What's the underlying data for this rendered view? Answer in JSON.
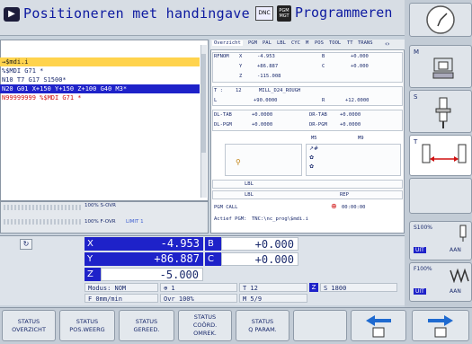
{
  "header": {
    "mode_title": "Positioneren met handingave",
    "dnc": "DNC",
    "pgm_badge": "PGM MGT",
    "program_title": "Programmeren"
  },
  "program": {
    "lines": [
      {
        "text": "→$mdi.i",
        "style": "arrow"
      },
      {
        "text": "%$MDI G71 *",
        "style": "normal"
      },
      {
        "text": "N10 T7 G17 S1500*",
        "style": "normal"
      },
      {
        "text": "N20 G01 X+150 Y+150 Z+100 G40 M3*",
        "style": "selected"
      },
      {
        "text": "N99999999 %$MDI G71 *",
        "style": "red"
      }
    ]
  },
  "status": {
    "tabs": [
      "Overzicht",
      "PGM",
      "PAL",
      "LBL",
      "CYC",
      "M",
      "POS",
      "TOOL",
      "TT",
      "TRANS"
    ],
    "rfnom": {
      "label": "RFNOM",
      "x_label": "X",
      "x": "-4.953",
      "y_label": "Y",
      "y": "+86.887",
      "z_label": "Z",
      "z": "-115.008",
      "b_label": "B",
      "b": "+0.000",
      "c_label": "C",
      "c": "+0.000"
    },
    "tool": {
      "t_label": "T :",
      "t_num": "12",
      "t_name": "MILL_D24_ROUGH",
      "l_label": "L",
      "l": "+90.0000",
      "r_label": "R",
      "r": "+12.0000"
    },
    "dl": {
      "dl_tab_label": "DL-TAB",
      "dl_tab": "+0.0000",
      "dr_tab_label": "DR-TAB",
      "dr_tab": "+0.0000",
      "dl_pgm_label": "DL-PGM",
      "dl_pgm": "+0.0000",
      "dr_pgm_label": "DR-PGM",
      "dr_pgm": "+0.0000"
    },
    "m5": "M5",
    "m9": "M9",
    "lbl1": "LBL",
    "lbl2": "LBL",
    "rep": "REP",
    "pgm_call": "PGM CALL",
    "timer": "00:00:00",
    "active_pgm_label": "Actief PGM:",
    "active_pgm": "TNC:\\nc_prog\\$mdi.i"
  },
  "overrides": {
    "s_ovr": "100% S-OVR",
    "f_ovr": "100% F-OVR",
    "limit": "LIMIT 1"
  },
  "axes": {
    "x_label": "X",
    "x": "-4.953",
    "b_label": "B",
    "b": "+0.000",
    "y_label": "Y",
    "y": "+86.887",
    "c_label": "C",
    "c": "+0.000",
    "z_label": "Z",
    "z": "-5.000",
    "modus": "Modus: NOM",
    "spindle_icon": "⊕ 1",
    "t": "T 12",
    "z_axis": "Z",
    "s": "S 1800",
    "f": "F 0mm/min",
    "ovr": "Ovr 100%",
    "m": "M 5/9"
  },
  "right_panel": {
    "m_key": "M",
    "s_key": "S",
    "t_key": "T",
    "s100": "S100%",
    "uit1": "UIT",
    "aan1": "AAN",
    "f100": "F100%",
    "uit2": "UIT",
    "aan2": "AAN"
  },
  "softkeys": [
    {
      "l1": "STATUS",
      "l2": "OVERZICHT"
    },
    {
      "l1": "STATUS",
      "l2": "POS.WEERG"
    },
    {
      "l1": "STATUS",
      "l2": "GEREED."
    },
    {
      "l1": "STATUS",
      "l2": "COÖRD.",
      "l3": "OMREK."
    },
    {
      "l1": "STATUS",
      "l2": "Q PARAM."
    }
  ],
  "colors": {
    "axis_blue": "#1e22c9",
    "selected_row": "#1e22c9",
    "arrow_row": "#ffd34d",
    "red_text": "#d01010"
  }
}
